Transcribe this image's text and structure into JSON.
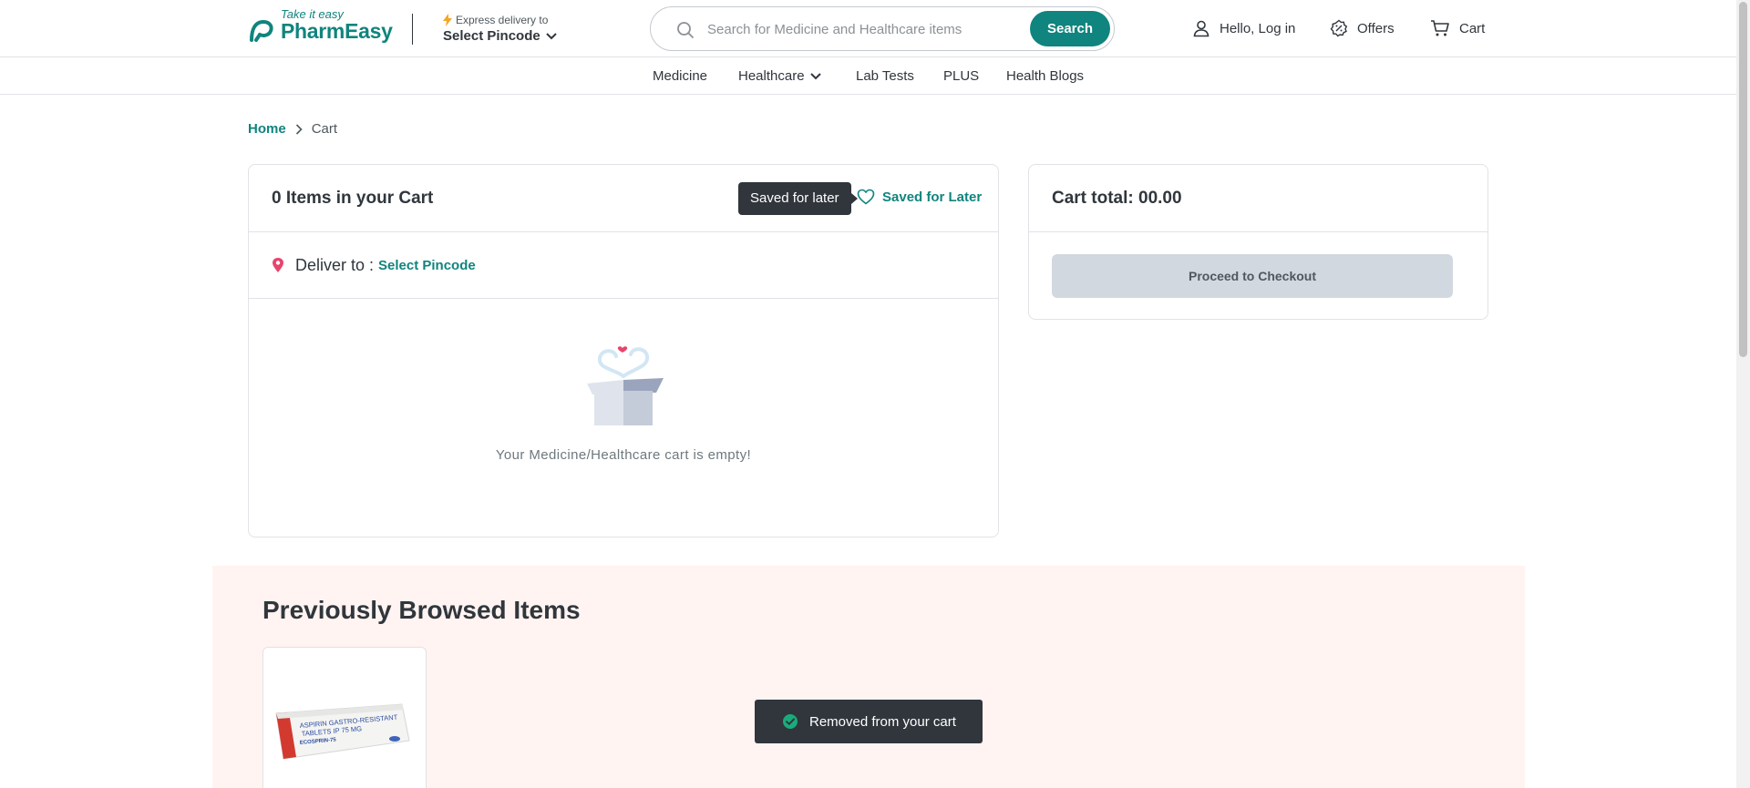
{
  "header": {
    "logo_tagline": "Take it easy",
    "logo_brand": "PharmEasy",
    "express_label": "Express delivery to",
    "pincode_label": "Select Pincode",
    "search": {
      "placeholder": "Search for Medicine and Healthcare items",
      "value": "",
      "button_label": "Search"
    },
    "login_label": "Hello, Log in",
    "offers_label": "Offers",
    "cart_label": "Cart"
  },
  "subnav": {
    "items": [
      "Medicine",
      "Healthcare",
      "Lab Tests",
      "PLUS",
      "Health Blogs"
    ]
  },
  "breadcrumb": {
    "home": "Home",
    "current": "Cart"
  },
  "cart": {
    "title": "0 Items in your Cart",
    "tooltip": "Saved for later",
    "saved_for_later": "Saved for Later",
    "deliver_label": "Deliver to :",
    "deliver_link": "Select Pincode",
    "empty_message": "Your Medicine/Healthcare cart is empty!"
  },
  "summary": {
    "total_label": "Cart total: 00.00",
    "checkout_label": "Proceed to Checkout"
  },
  "previously_browsed": {
    "title": "Previously Browsed Items",
    "products": [
      {
        "image_text": [
          "ASPIRIN GASTRO-RESISTANT",
          "TABLETS IP 75 MG",
          "ECOSPRIN-75"
        ]
      }
    ]
  },
  "toast": {
    "message": "Removed from your cart"
  },
  "colors": {
    "brand": "#10847e",
    "text": "#30363c",
    "border": "#e0e3e6",
    "section_bg": "#fff4f1",
    "toast_bg": "#30363c",
    "accent_pink": "#e8446e"
  }
}
